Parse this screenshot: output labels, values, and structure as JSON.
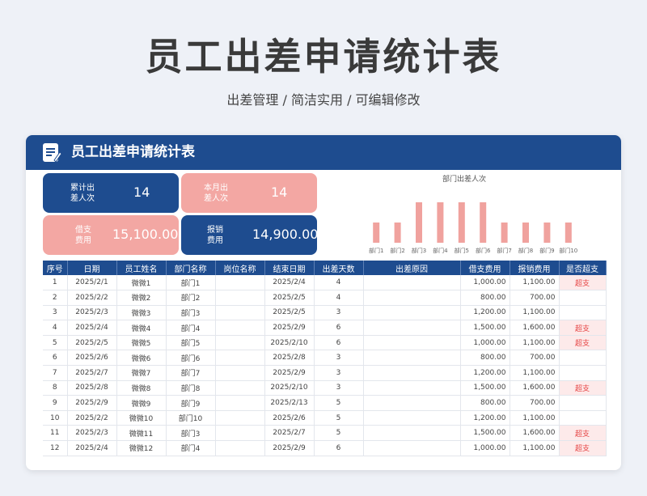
{
  "page": {
    "title": "员工出差申请统计表",
    "subtitle": "出差管理 /  简洁实用  /  可编辑修改"
  },
  "card": {
    "title": "员工出差申请统计表"
  },
  "stats": {
    "total_trips": {
      "label_line1": "累计出",
      "label_line2": "差人次",
      "value": "14"
    },
    "month_trips": {
      "label_line1": "本月出",
      "label_line2": "差人次",
      "value": "14"
    },
    "advance": {
      "label_line1": "借支",
      "label_line2": "费用",
      "value": "15,100.00"
    },
    "reimburse": {
      "label_line1": "报销",
      "label_line2": "费用",
      "value": "14,900.00"
    }
  },
  "colors": {
    "primary": "#1e4c8f",
    "accent_pink": "#f3a7a3",
    "bar": "#f0a29e",
    "over_text": "#e64646"
  },
  "chart_data": {
    "type": "bar",
    "title": "部门出差人次",
    "categories": [
      "部门1",
      "部门2",
      "部门3",
      "部门4",
      "部门5",
      "部门6",
      "部门7",
      "部门8",
      "部门9",
      "部门10"
    ],
    "values": [
      1,
      1,
      2,
      2,
      2,
      2,
      1,
      1,
      1,
      1
    ],
    "ylim": [
      0,
      2
    ],
    "grid": false,
    "legend": "none"
  },
  "table": {
    "headers": [
      "序号",
      "日期",
      "员工姓名",
      "部门名称",
      "岗位名称",
      "结束日期",
      "出差天数",
      "出差原因",
      "借支费用",
      "报销费用",
      "是否超支"
    ],
    "rows": [
      [
        "1",
        "2025/2/1",
        "微微1",
        "部门1",
        "",
        "2025/2/4",
        "4",
        "",
        "1,000.00",
        "1,100.00",
        "超支"
      ],
      [
        "2",
        "2025/2/2",
        "微微2",
        "部门2",
        "",
        "2025/2/5",
        "4",
        "",
        "800.00",
        "700.00",
        ""
      ],
      [
        "3",
        "2025/2/3",
        "微微3",
        "部门3",
        "",
        "2025/2/5",
        "3",
        "",
        "1,200.00",
        "1,100.00",
        ""
      ],
      [
        "4",
        "2025/2/4",
        "微微4",
        "部门4",
        "",
        "2025/2/9",
        "6",
        "",
        "1,500.00",
        "1,600.00",
        "超支"
      ],
      [
        "5",
        "2025/2/5",
        "微微5",
        "部门5",
        "",
        "2025/2/10",
        "6",
        "",
        "1,000.00",
        "1,100.00",
        "超支"
      ],
      [
        "6",
        "2025/2/6",
        "微微6",
        "部门6",
        "",
        "2025/2/8",
        "3",
        "",
        "800.00",
        "700.00",
        ""
      ],
      [
        "7",
        "2025/2/7",
        "微微7",
        "部门7",
        "",
        "2025/2/9",
        "3",
        "",
        "1,200.00",
        "1,100.00",
        ""
      ],
      [
        "8",
        "2025/2/8",
        "微微8",
        "部门8",
        "",
        "2025/2/10",
        "3",
        "",
        "1,500.00",
        "1,600.00",
        "超支"
      ],
      [
        "9",
        "2025/2/9",
        "微微9",
        "部门9",
        "",
        "2025/2/13",
        "5",
        "",
        "800.00",
        "700.00",
        ""
      ],
      [
        "10",
        "2025/2/2",
        "微微10",
        "部门10",
        "",
        "2025/2/6",
        "5",
        "",
        "1,200.00",
        "1,100.00",
        ""
      ],
      [
        "11",
        "2025/2/3",
        "微微11",
        "部门3",
        "",
        "2025/2/7",
        "5",
        "",
        "1,500.00",
        "1,600.00",
        "超支"
      ],
      [
        "12",
        "2025/2/4",
        "微微12",
        "部门4",
        "",
        "2025/2/9",
        "6",
        "",
        "1,000.00",
        "1,100.00",
        "超支"
      ]
    ]
  }
}
